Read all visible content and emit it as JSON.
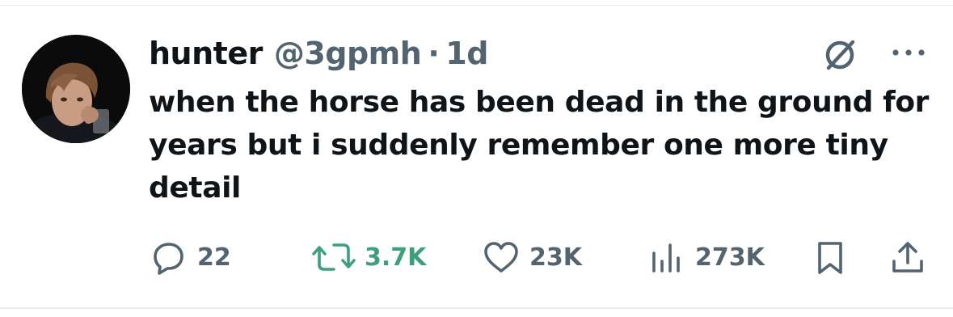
{
  "tweet": {
    "author_name": "hunter",
    "author_handle": "@3gpmh",
    "separator": "·",
    "time": "1d",
    "text": "when the horse has been dead in the ground for years but i suddenly remember one more tiny detail"
  },
  "actions": {
    "replies": "22",
    "reposts": "3.7K",
    "likes": "23K",
    "views": "273K"
  },
  "colors": {
    "text_primary": "#0f1419",
    "text_secondary": "#536471",
    "repost_active": "#3da07a",
    "divider": "#e9ebec"
  },
  "icons": {
    "grok": "grok-icon",
    "more": "more-icon",
    "reply": "reply-icon",
    "repost": "repost-icon",
    "like": "heart-icon",
    "views": "views-icon",
    "bookmark": "bookmark-icon",
    "share": "share-icon"
  }
}
